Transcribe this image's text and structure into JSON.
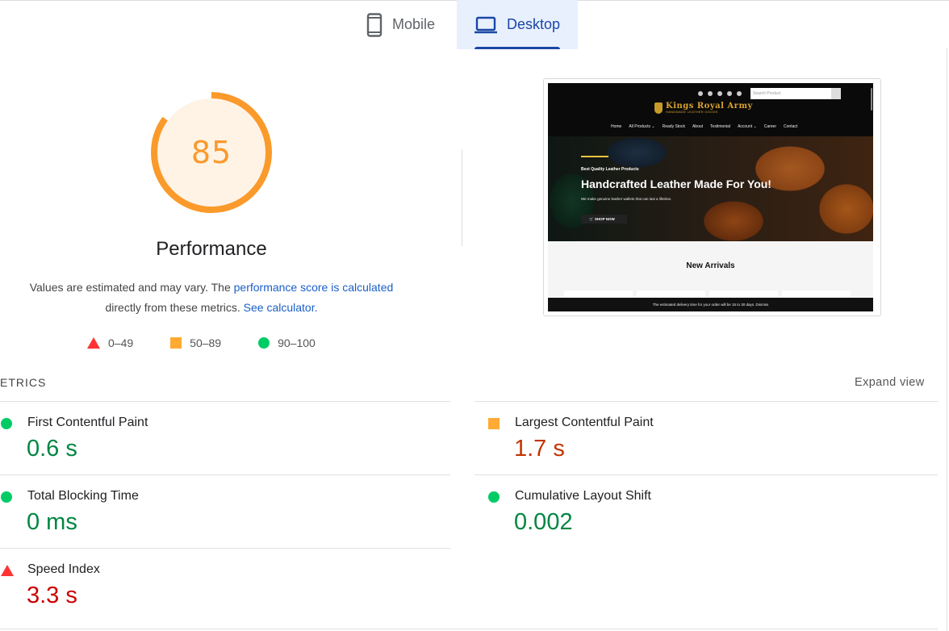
{
  "tabs": [
    {
      "label": "Mobile",
      "icon": "smartphone-icon",
      "selected": false
    },
    {
      "label": "Desktop",
      "icon": "laptop-icon",
      "selected": true
    }
  ],
  "performance": {
    "score": "85",
    "score_fraction": 0.85,
    "title": "Performance",
    "desc_prefix": "Values are estimated and may vary. The ",
    "desc_link1": "performance score is calculated",
    "desc_middle": "directly from these metrics.",
    "desc_link2": "See calculator.",
    "colors": {
      "gauge": "#fa9a2b",
      "gauge_bg": "#fff3e6"
    }
  },
  "legend": [
    {
      "shape": "triangle",
      "range": "0–49",
      "color": "#ff3333"
    },
    {
      "shape": "square",
      "range": "50–89",
      "color": "#ffaa33"
    },
    {
      "shape": "circle",
      "range": "90–100",
      "color": "#00cc66"
    }
  ],
  "preview": {
    "search_placeholder": "Search Product",
    "logo_title": "Kings Royal Army",
    "logo_subtitle": "HANDMADE LEATHER GOODS",
    "nav": [
      "Home",
      "All Products ⌄",
      "Ready Stock",
      "About",
      "Testimonial",
      "Account ⌄",
      "Career",
      "Contact"
    ],
    "hero_kicker": "Best Quality Leather Products",
    "hero_heading": "Handcrafted Leather Made For You!",
    "hero_sub": "We make genuine leather wallets that can last a lifetime.",
    "hero_button": "🛒 SHOP NOW",
    "section_heading": "New Arrivals",
    "footer_text": "The estimated delivery time for your order will be 15 to 30 days. Dismiss"
  },
  "metrics": {
    "title": "ETRICS",
    "expand_label": "Expand view",
    "items": [
      {
        "label": "First Contentful Paint",
        "value": "0.6 s",
        "rating": "good"
      },
      {
        "label": "Largest Contentful Paint",
        "value": "1.7 s",
        "rating": "average"
      },
      {
        "label": "Total Blocking Time",
        "value": "0 ms",
        "rating": "good"
      },
      {
        "label": "Cumulative Layout Shift",
        "value": "0.002",
        "rating": "good"
      },
      {
        "label": "Speed Index",
        "value": "3.3 s",
        "rating": "poor"
      }
    ]
  }
}
